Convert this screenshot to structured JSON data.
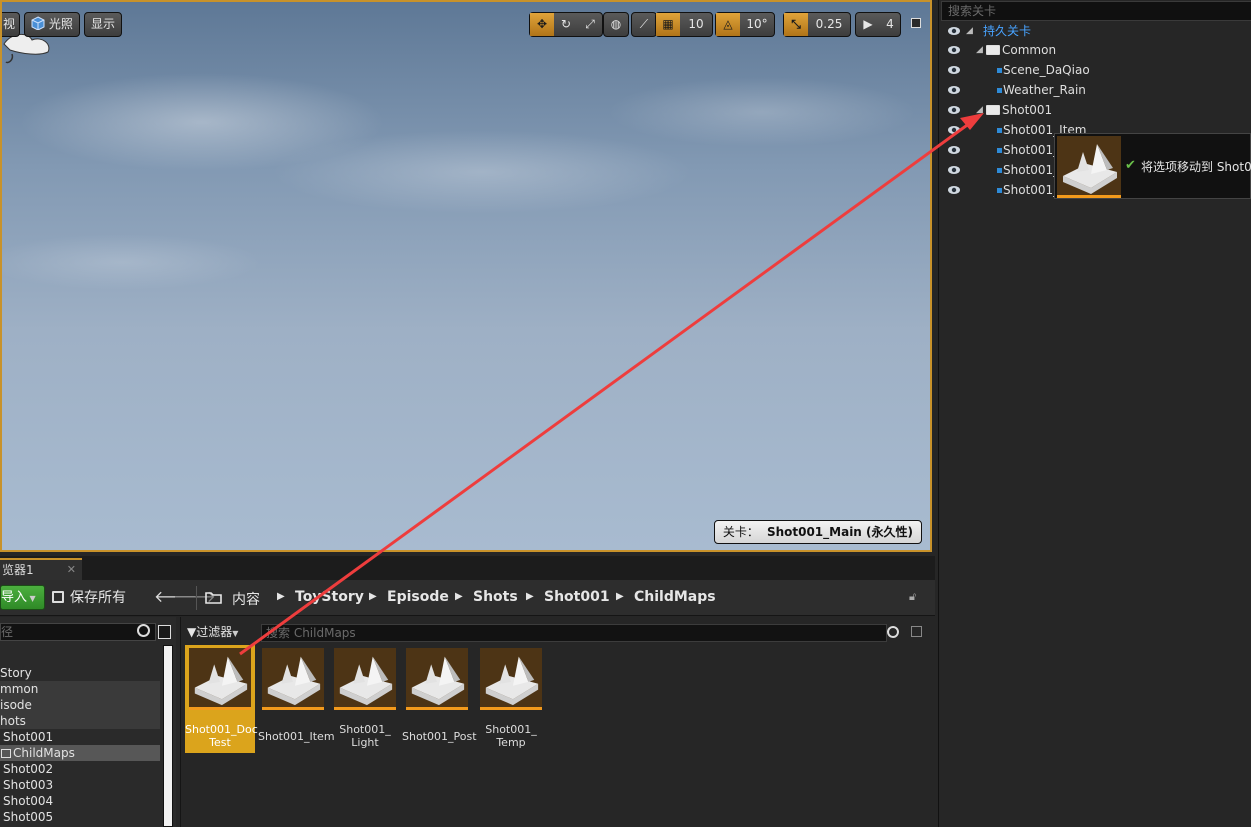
{
  "viewport": {
    "perspective_label": "视",
    "lit_label": "光照",
    "show_label": "显示",
    "grid_snap_value": "10",
    "rotate_snap_value": "10°",
    "scale_snap_value": "0.25",
    "camera_speed_value": "4",
    "level_label_prefix": "关卡：",
    "level_label_name": "Shot001_Main (永久性)"
  },
  "levels_panel": {
    "search_placeholder": "搜索关卡",
    "rows": [
      {
        "label": "持久关卡"
      },
      {
        "label": "Common"
      },
      {
        "label": "Scene_DaQiao"
      },
      {
        "label": "Weather_Rain"
      },
      {
        "label": "Shot001"
      },
      {
        "label": "Shot001_Item"
      },
      {
        "label": "Shot001_"
      },
      {
        "label": "Shot001_"
      },
      {
        "label": "Shot001_"
      }
    ],
    "drag_tooltip": "将选项移动到 Shot00"
  },
  "content_browser": {
    "tab_label": "览器1",
    "import_label": "导入",
    "save_all_label": "保存所有",
    "breadcrumbs": [
      "内容",
      "ToyStory",
      "Episode",
      "Shots",
      "Shot001",
      "ChildMaps"
    ],
    "path_search_placeholder": "径",
    "tree": [
      "Story",
      "mmon",
      "isode",
      "hots",
      "Shot001",
      "ChildMaps",
      "Shot002",
      "Shot003",
      "Shot004",
      "Shot005"
    ],
    "filter_label": "过滤器",
    "asset_search_placeholder": "搜索 ChildMaps",
    "assets": [
      {
        "label": "Shot001_Doc Test"
      },
      {
        "label": "Shot001_Item"
      },
      {
        "label": "Shot001_ Light"
      },
      {
        "label": "Shot001_Post"
      },
      {
        "label": "Shot001_ Temp"
      }
    ]
  },
  "colors": {
    "accent": "#c8922a",
    "import_green": "#3f9e34",
    "selection_gold": "#dba41c",
    "level_blue": "#48a3ff",
    "drag_arrow": "#ee3d3d"
  }
}
